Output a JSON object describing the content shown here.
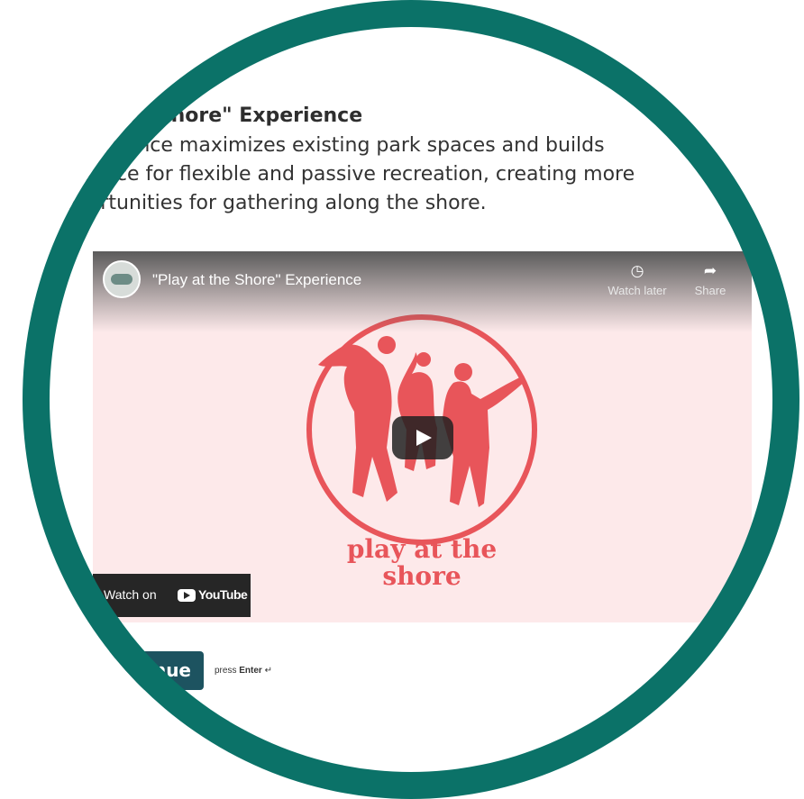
{
  "section": {
    "title": "y at the Shore\" Experience",
    "description_lines": [
      "experience maximizes existing park spaces and builds",
      "v space for flexible and passive recreation, creating more",
      "pportunities for gathering along the shore."
    ]
  },
  "video": {
    "title": "\"Play at the Shore\" Experience",
    "watch_later_label": "Watch later",
    "share_label": "Share",
    "logo_line1": "play at the",
    "logo_line2": "shore",
    "watch_on_label": "Watch on",
    "youtube_label": "YouTube",
    "icons": [
      "clock-icon",
      "share-arrow-icon",
      "play-icon",
      "youtube-logo-icon",
      "channel-avatar-icon"
    ]
  },
  "actions": {
    "continue_label": "inue",
    "hint_prefix": "press",
    "hint_key": "Enter",
    "hint_symbol": "↵"
  },
  "colors": {
    "ring": "#0b7268",
    "button": "#1d5360",
    "brand": "#e8555a",
    "video_bg": "#fde9ea"
  }
}
